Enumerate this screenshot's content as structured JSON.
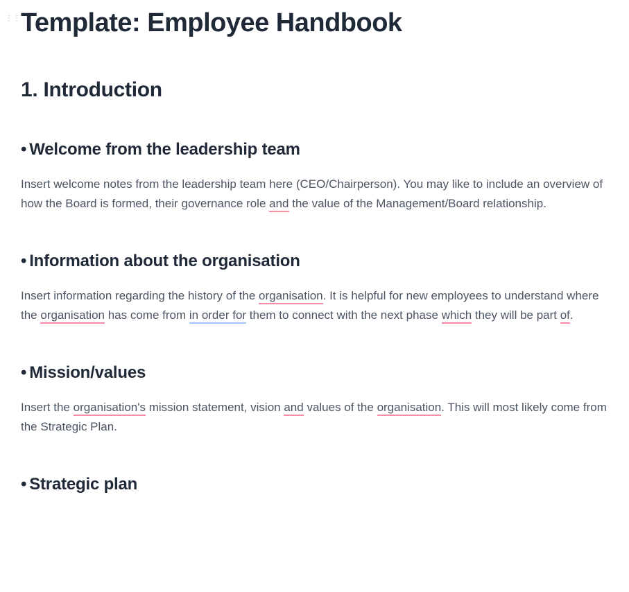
{
  "title": "Template: Employee Handbook",
  "section": {
    "heading": "1. Introduction"
  },
  "subsections": {
    "welcome": {
      "heading": "Welcome from the leadership team",
      "para": {
        "t1": "Insert welcome notes from the leadership team here (CEO/Chairperson). You may like to include an overview of how the Board is formed, their governance role ",
        "u1": "and",
        "t2": " the value of the Management/Board relationship."
      }
    },
    "info": {
      "heading": "Information about the organisation",
      "para": {
        "t1": "Insert information regarding the history of the ",
        "u1": "organisation",
        "t2": ". It is helpful for new employees to understand where the ",
        "u2": "organisation",
        "t3": " has come from ",
        "u3": "in order for",
        "t4": " them to connect with the next phase ",
        "u4": "which",
        "t5": " they will be part ",
        "u5": "of",
        "t6": "."
      }
    },
    "mission": {
      "heading": "Mission/values",
      "para": {
        "t1": "Insert the ",
        "u1": "organisation's",
        "t2": " mission statement, vision ",
        "u2": "and",
        "t3": " values of the ",
        "u3": "organisation",
        "t4": ". This will most likely come from the Strategic Plan."
      }
    },
    "strategic": {
      "heading": "Strategic plan"
    }
  }
}
